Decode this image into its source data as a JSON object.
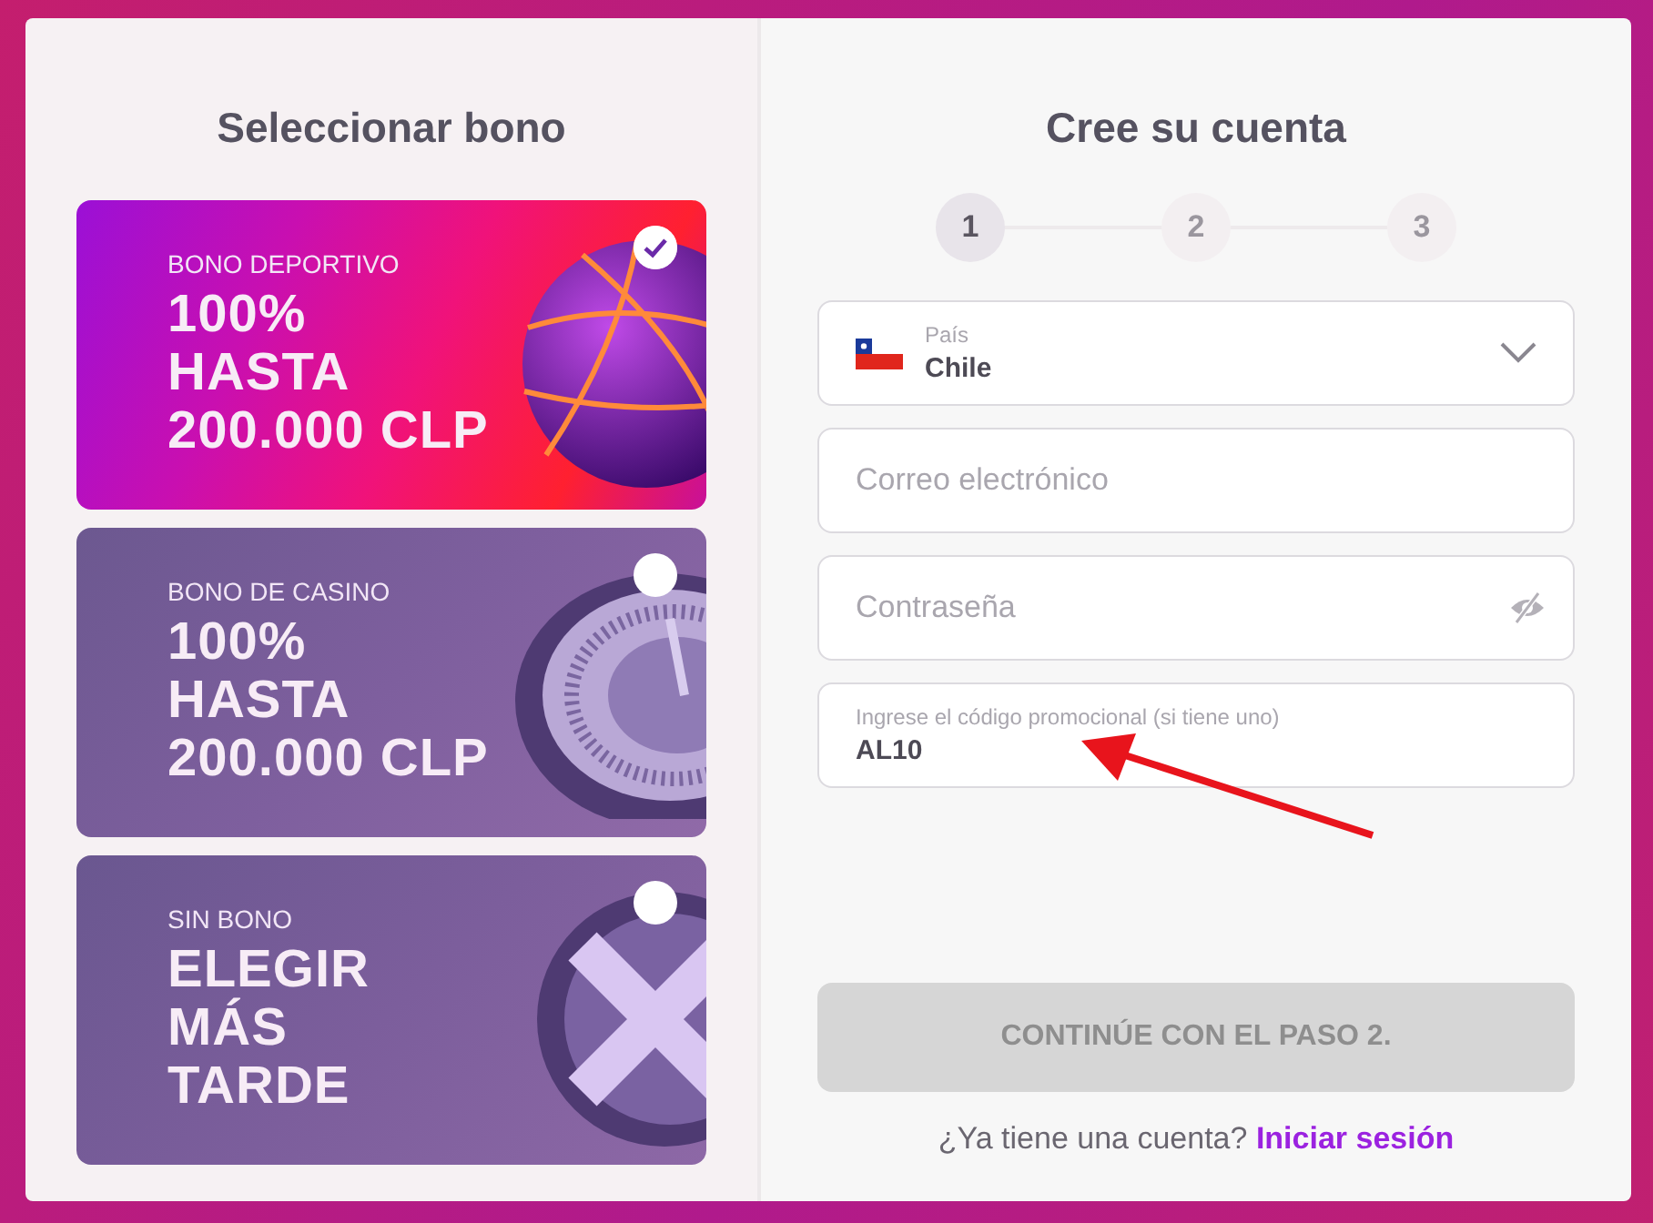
{
  "bonus_panel": {
    "title": "Seleccionar bono",
    "bonuses": [
      {
        "kind": "sport",
        "category": "BONO DEPORTIVO",
        "headline": "100%\nHASTA\n200.000 CLP",
        "selected": true
      },
      {
        "kind": "casino",
        "category": "BONO DE CASINO",
        "headline": "100%\nHASTA\n200.000 CLP",
        "selected": false
      },
      {
        "kind": "none",
        "category": "SIN BONO",
        "headline": "ELEGIR\nMÁS\nTARDE",
        "selected": false
      }
    ]
  },
  "signup_panel": {
    "title": "Cree su cuenta",
    "steps": [
      {
        "label": "1",
        "selected": true
      },
      {
        "label": "2",
        "selected": false
      },
      {
        "label": "3",
        "selected": false
      }
    ],
    "fields": [
      {
        "kind": "select",
        "label": "País",
        "value": "Chile"
      },
      {
        "kind": "text",
        "placeholder": "Correo electrónico"
      },
      {
        "kind": "password",
        "placeholder": "Contraseña"
      },
      {
        "kind": "labeled",
        "label": "Ingrese el código promocional (si tiene uno)",
        "value": "AL10"
      }
    ],
    "submit": {
      "label": "CONTINÚE CON EL PASO 2.",
      "disabled": true
    },
    "login_prompt": {
      "text": "¿Ya tiene una cuenta?",
      "link": "Iniciar sesión"
    }
  }
}
